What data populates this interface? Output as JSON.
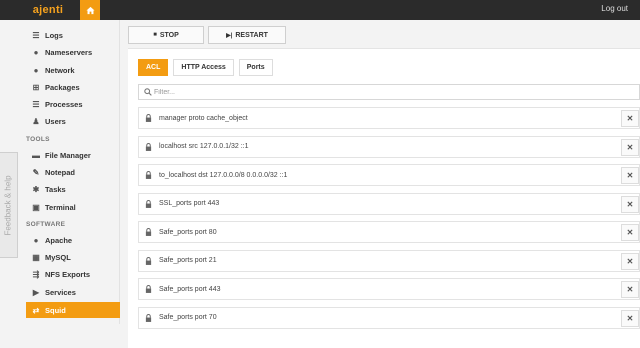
{
  "topbar": {
    "brand": "ajenti",
    "logout": "Log out",
    "home_icon": "home-icon"
  },
  "sidebar": {
    "items_top": [
      {
        "label": "Logs",
        "icon": "list-icon"
      },
      {
        "label": "Nameservers",
        "icon": "globe-icon"
      },
      {
        "label": "Network",
        "icon": "globe-icon"
      },
      {
        "label": "Packages",
        "icon": "gift-icon"
      },
      {
        "label": "Processes",
        "icon": "list-icon"
      },
      {
        "label": "Users",
        "icon": "group-icon"
      }
    ],
    "tools_label": "TOOLS",
    "items_tools": [
      {
        "label": "File Manager",
        "icon": "folder-icon"
      },
      {
        "label": "Notepad",
        "icon": "edit-icon"
      },
      {
        "label": "Tasks",
        "icon": "gear-icon"
      },
      {
        "label": "Terminal",
        "icon": "terminal-icon"
      }
    ],
    "software_label": "SOFTWARE",
    "items_software": [
      {
        "label": "Apache",
        "icon": "globe-icon"
      },
      {
        "label": "MySQL",
        "icon": "table-icon"
      },
      {
        "label": "NFS Exports",
        "icon": "share-icon"
      },
      {
        "label": "Services",
        "icon": "play-icon"
      },
      {
        "label": "Squid",
        "icon": "exchange-icon",
        "active": true
      }
    ],
    "feedback": "Feedback & help"
  },
  "toolbar": {
    "stop": "STOP",
    "restart": "RESTART"
  },
  "tabs": [
    {
      "label": "ACL",
      "active": true
    },
    {
      "label": "HTTP Access"
    },
    {
      "label": "Ports"
    }
  ],
  "filter": {
    "placeholder": "Filter..."
  },
  "acl_rows": [
    "manager proto cache_object",
    "localhost src 127.0.0.1/32 ::1",
    "to_localhost dst 127.0.0.0/8 0.0.0.0/32 ::1",
    "SSL_ports port 443",
    "Safe_ports port 80",
    "Safe_ports port 21",
    "Safe_ports port 443",
    "Safe_ports port 70"
  ],
  "colors": {
    "accent": "#f39c12",
    "topbar": "#2b2b2b",
    "brand": "#f6a21e"
  }
}
